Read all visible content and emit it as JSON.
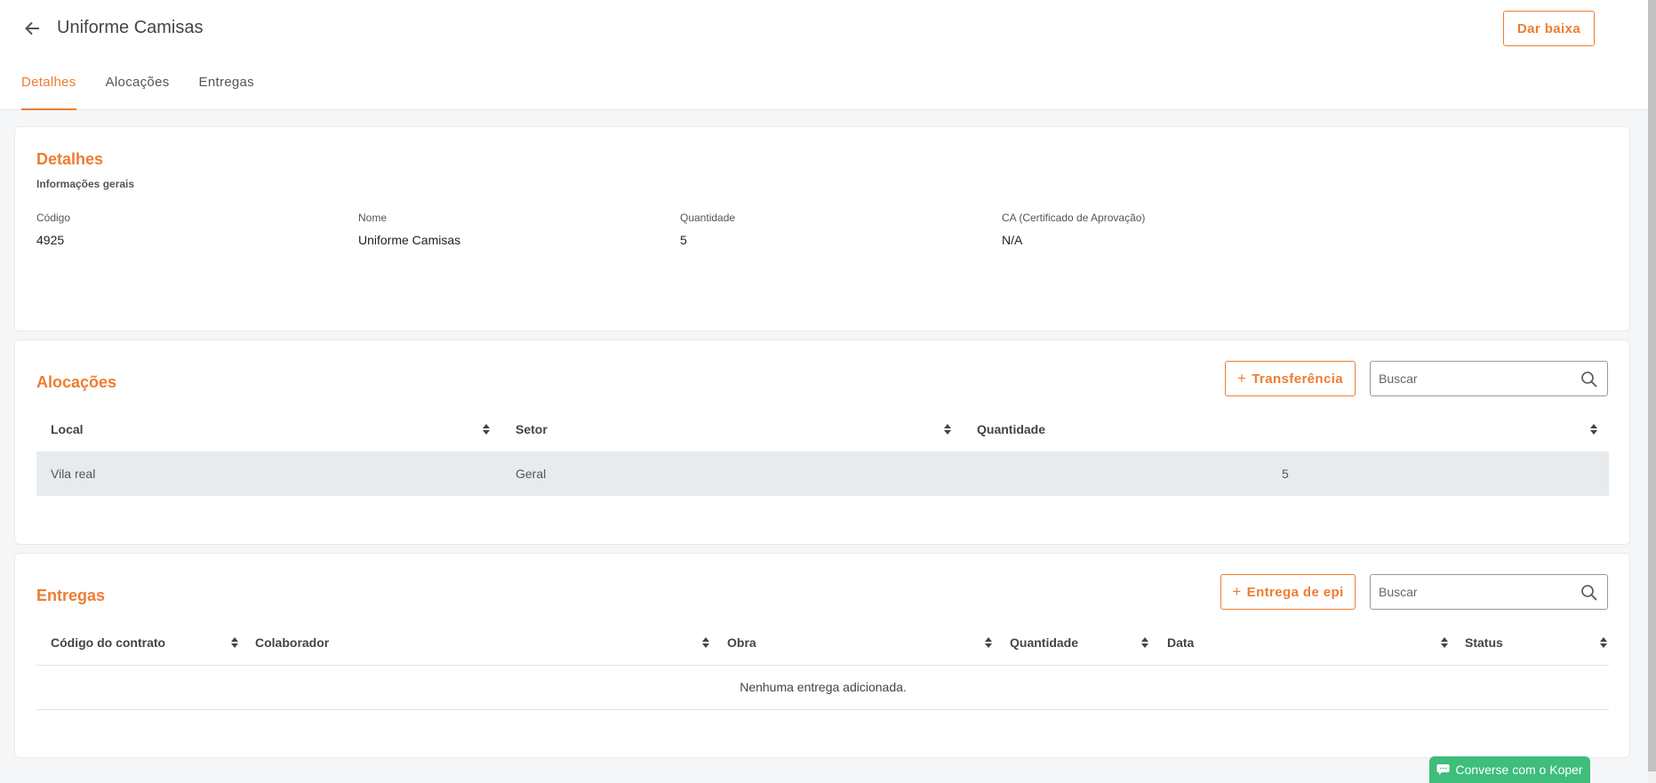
{
  "header": {
    "title": "Uniforme Camisas",
    "back_icon": "arrow-left-icon",
    "action_button": "Dar baixa"
  },
  "tabs": [
    {
      "label": "Detalhes",
      "active": true
    },
    {
      "label": "Alocações",
      "active": false
    },
    {
      "label": "Entregas",
      "active": false
    }
  ],
  "details": {
    "title": "Detalhes",
    "subtitle": "Informações gerais",
    "fields": [
      {
        "label": "Código",
        "value": "4925"
      },
      {
        "label": "Nome",
        "value": "Uniforme Camisas"
      },
      {
        "label": "Quantidade",
        "value": "5"
      },
      {
        "label": "CA (Certificado de Aprovação)",
        "value": "N/A"
      }
    ]
  },
  "allocations": {
    "title": "Alocações",
    "add_button": "Transferência",
    "search_placeholder": "Buscar",
    "columns": [
      "Local",
      "Setor",
      "Quantidade"
    ],
    "rows": [
      {
        "local": "Vila real",
        "setor": "Geral",
        "quantidade": "5"
      }
    ]
  },
  "deliveries": {
    "title": "Entregas",
    "add_button": "Entrega de epi",
    "search_placeholder": "Buscar",
    "columns": [
      "Código do contrato",
      "Colaborador",
      "Obra",
      "Quantidade",
      "Data",
      "Status"
    ],
    "empty_message": "Nenhuma entrega adicionada."
  },
  "chat": {
    "label": "Converse com o Koper"
  },
  "colors": {
    "accent": "#ed7d31",
    "chat": "#3fbd7a",
    "row_highlight": "#e8ebee"
  }
}
